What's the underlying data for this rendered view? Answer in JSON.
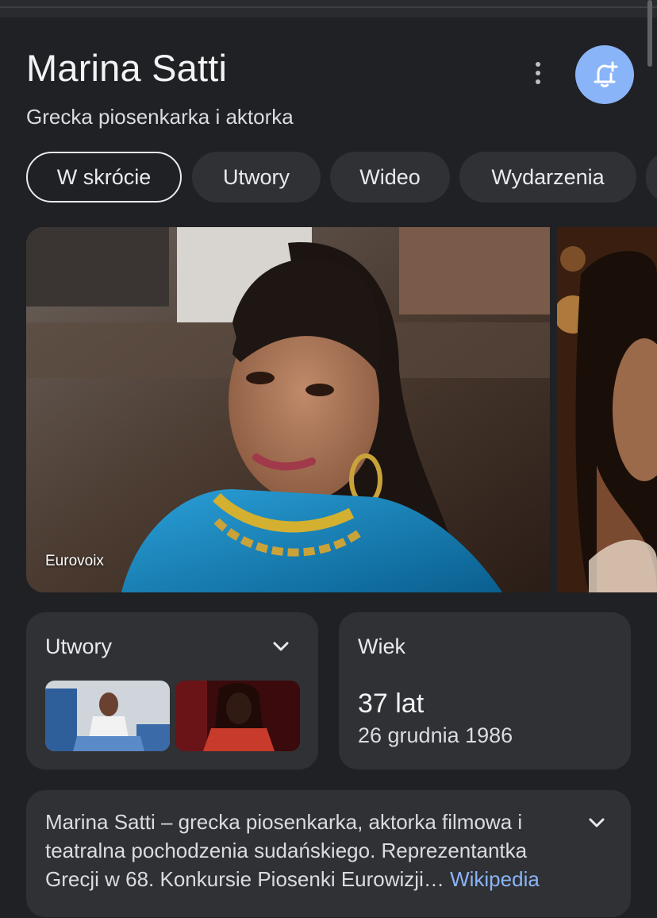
{
  "knowledge_panel": {
    "title": "Marina Satti",
    "subtitle": "Grecka piosenkarka i aktorka",
    "more_icon": "more-vert-icon",
    "follow_icon": "bell-add-icon",
    "accent_color": "#8ab4f8"
  },
  "tabs": [
    {
      "label": "W skrócie",
      "active": true
    },
    {
      "label": "Utwory",
      "active": false
    },
    {
      "label": "Wideo",
      "active": false
    },
    {
      "label": "Wydarzenia",
      "active": false
    }
  ],
  "hero_image": {
    "source": "Eurovoix"
  },
  "songs_card": {
    "title": "Utwory"
  },
  "age_card": {
    "title": "Wiek",
    "value": "37 lat",
    "birth_date": "26 grudnia 1986"
  },
  "description": {
    "text": "Marina Satti – grecka piosenkarka, aktorka filmowa i teatralna pochodzenia sudańskiego. Reprezentantka Grecji w 68. Konkursie Piosenki Eurowizji…",
    "link_label": "Wikipedia"
  }
}
